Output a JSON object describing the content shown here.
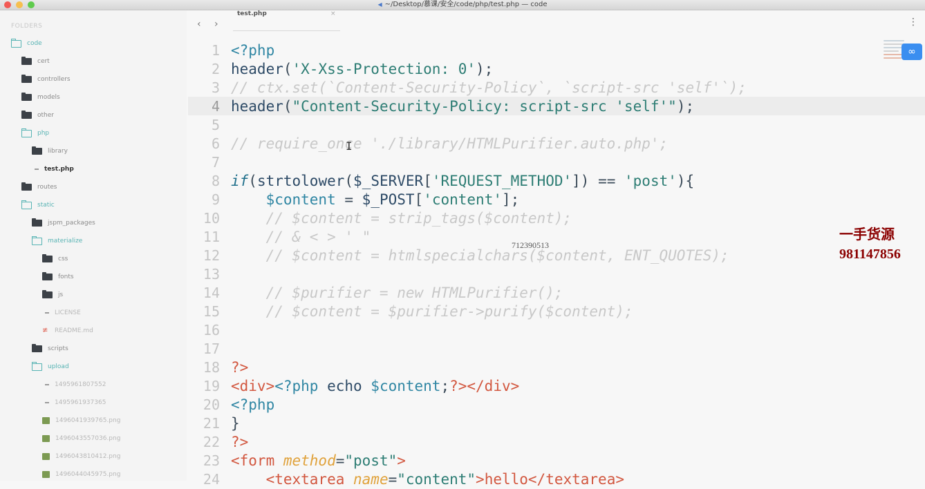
{
  "window": {
    "title": "~/Desktop/慕课/安全/code/php/test.php — code"
  },
  "sidebar": {
    "header": "FOLDERS",
    "items": [
      {
        "label": "code",
        "type": "folder-open",
        "indent": 0
      },
      {
        "label": "cert",
        "type": "folder",
        "indent": 1
      },
      {
        "label": "controllers",
        "type": "folder",
        "indent": 1
      },
      {
        "label": "models",
        "type": "folder",
        "indent": 1
      },
      {
        "label": "other",
        "type": "folder",
        "indent": 1
      },
      {
        "label": "php",
        "type": "folder-open",
        "indent": 1
      },
      {
        "label": "library",
        "type": "folder",
        "indent": 2
      },
      {
        "label": "test.php",
        "type": "file-active",
        "indent": 2
      },
      {
        "label": "routes",
        "type": "folder",
        "indent": 1
      },
      {
        "label": "static",
        "type": "folder-open",
        "indent": 1
      },
      {
        "label": "jspm_packages",
        "type": "folder",
        "indent": 2
      },
      {
        "label": "materialize",
        "type": "folder-open",
        "indent": 2
      },
      {
        "label": "css",
        "type": "folder",
        "indent": 3
      },
      {
        "label": "fonts",
        "type": "folder",
        "indent": 3
      },
      {
        "label": "js",
        "type": "folder",
        "indent": 3
      },
      {
        "label": "LICENSE",
        "type": "file",
        "indent": 3
      },
      {
        "label": "README.md",
        "type": "md",
        "indent": 3
      },
      {
        "label": "scripts",
        "type": "folder",
        "indent": 2
      },
      {
        "label": "upload",
        "type": "folder-open",
        "indent": 2
      },
      {
        "label": "1495961807552",
        "type": "file",
        "indent": 3
      },
      {
        "label": "1495961937365",
        "type": "file",
        "indent": 3
      },
      {
        "label": "1496041939765.png",
        "type": "png",
        "indent": 3
      },
      {
        "label": "1496043557036.png",
        "type": "png",
        "indent": 3
      },
      {
        "label": "1496043810412.png",
        "type": "png",
        "indent": 3
      },
      {
        "label": "1496044045975.png",
        "type": "png",
        "indent": 3
      }
    ]
  },
  "tabs": {
    "back": "‹",
    "forward": "›",
    "active_tab": "test.php",
    "close": "×",
    "menu": "⋮"
  },
  "editor": {
    "current_line": 4,
    "lines": [
      [
        [
          "<?php",
          "t-kw"
        ]
      ],
      [
        [
          "header",
          "t-fn"
        ],
        [
          "(",
          "t-punc"
        ],
        [
          "'X-Xss-Protection: 0'",
          "t-str"
        ],
        [
          ");",
          "t-punc"
        ]
      ],
      [
        [
          "// ctx.set(`Content-Security-Policy`, `script-src 'self'`);",
          "t-cm"
        ]
      ],
      [
        [
          "header",
          "t-fn"
        ],
        [
          "(",
          "t-punc"
        ],
        [
          "\"Content-Security-Policy: script-src 'self'\"",
          "t-str"
        ],
        [
          ");",
          "t-punc"
        ]
      ],
      [],
      [
        [
          "// require_once './library/HTMLPurifier.auto.php';",
          "t-cm"
        ]
      ],
      [],
      [
        [
          "if",
          "t-it"
        ],
        [
          "(",
          "t-punc"
        ],
        [
          "strtolower",
          "t-fn"
        ],
        [
          "(",
          "t-punc"
        ],
        [
          "$_SERVER",
          "t-fn"
        ],
        [
          "[",
          "t-punc"
        ],
        [
          "'REQUEST_METHOD'",
          "t-str"
        ],
        [
          "]) == ",
          "t-punc"
        ],
        [
          "'post'",
          "t-str"
        ],
        [
          "){",
          "t-punc"
        ]
      ],
      [
        [
          "    ",
          "t-punc"
        ],
        [
          "$content",
          "t-var"
        ],
        [
          " = ",
          "t-punc"
        ],
        [
          "$_POST",
          "t-fn"
        ],
        [
          "[",
          "t-punc"
        ],
        [
          "'content'",
          "t-str"
        ],
        [
          "];",
          "t-punc"
        ]
      ],
      [
        [
          "    // $content = strip_tags($content);",
          "t-cm"
        ]
      ],
      [
        [
          "    // & < > ' \"",
          "t-cm"
        ]
      ],
      [
        [
          "    // $content = htmlspecialchars($content, ENT_QUOTES);",
          "t-cm"
        ]
      ],
      [],
      [
        [
          "    // $purifier = new HTMLPurifier();",
          "t-cm"
        ]
      ],
      [
        [
          "    // $content = $purifier->purify($content);",
          "t-cm"
        ]
      ],
      [],
      [],
      [
        [
          "?>",
          "t-tag"
        ]
      ],
      [
        [
          "<div>",
          "t-tag"
        ],
        [
          "<?php ",
          "t-kw"
        ],
        [
          "echo ",
          "t-fn"
        ],
        [
          "$content",
          "t-var"
        ],
        [
          ";",
          "t-punc"
        ],
        [
          "?></div>",
          "t-tag"
        ]
      ],
      [
        [
          "<?php",
          "t-kw"
        ]
      ],
      [
        [
          "}",
          "t-punc"
        ]
      ],
      [
        [
          "?>",
          "t-tag"
        ]
      ],
      [
        [
          "<form ",
          "t-tag"
        ],
        [
          "method",
          "t-attr"
        ],
        [
          "=",
          "t-punc"
        ],
        [
          "\"post\"",
          "t-str"
        ],
        [
          ">",
          "t-tag"
        ]
      ],
      [
        [
          "    <textarea ",
          "t-tag"
        ],
        [
          "name",
          "t-attr"
        ],
        [
          "=",
          "t-punc"
        ],
        [
          "\"content\"",
          "t-str"
        ],
        [
          ">hello</textarea>",
          "t-tag"
        ]
      ]
    ]
  },
  "watermark": {
    "center": "712390513",
    "right_line1": "一手货源",
    "right_line2": "981147856"
  },
  "colors": {
    "accent": "#56b3b3",
    "share_badge": "#3a8ef0",
    "keyword": "#2f86a3",
    "string": "#2d7d74",
    "tag": "#d2573f",
    "attr": "#e0a23b",
    "comment": "#c8c8c8"
  }
}
